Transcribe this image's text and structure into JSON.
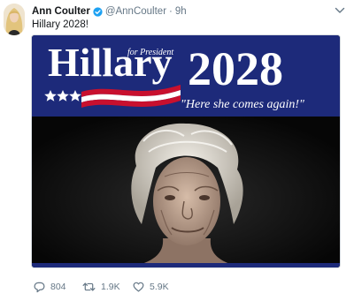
{
  "tweet": {
    "author": {
      "display_name": "Ann Coulter",
      "handle": "@AnnCoulter",
      "verified": true,
      "avatar_icon": "profile-photo"
    },
    "separator": "·",
    "timestamp": "9h",
    "text": "Hillary 2028!",
    "media": {
      "headline_name": "Hillary",
      "headline_tag": "for President",
      "headline_year": "2028",
      "tagline": "\"Here she comes again!\"",
      "banner_color": "#1d2a7a",
      "stripe_red": "#c8102e"
    },
    "actions": {
      "reply_icon": "speech-bubble-icon",
      "reply_count": "804",
      "retweet_icon": "retweet-arrows-icon",
      "retweet_count": "1.9K",
      "like_icon": "heart-icon",
      "like_count": "5.9K"
    },
    "menu_icon": "chevron-down-icon"
  },
  "colors": {
    "text": "#14171a",
    "muted": "#657786",
    "verified_blue": "#1da1f2"
  }
}
